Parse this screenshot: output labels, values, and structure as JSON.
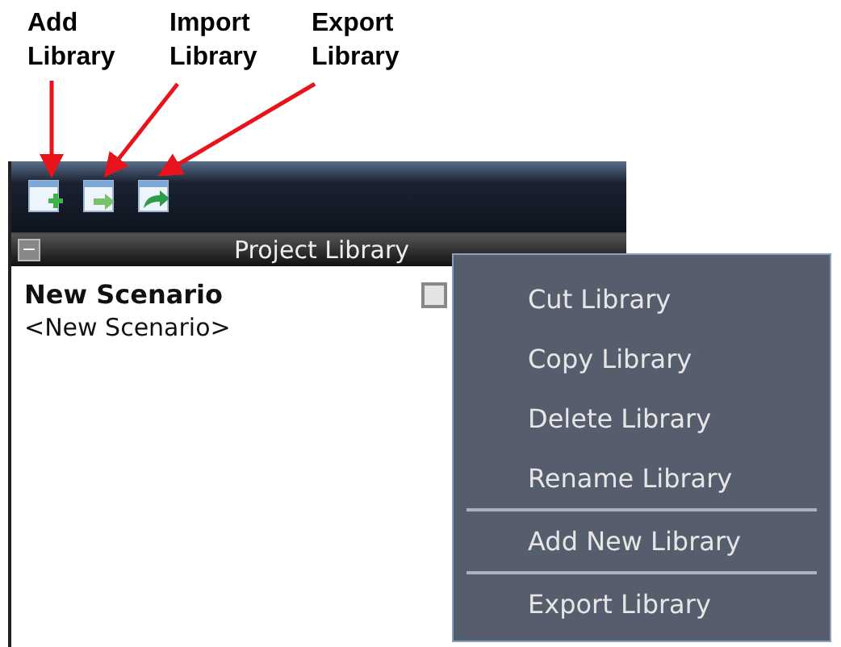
{
  "annotations": [
    {
      "label": "Add Library"
    },
    {
      "label": "Import Library"
    },
    {
      "label": "Export Library"
    }
  ],
  "toolbar": {
    "buttons": [
      {
        "kind": "add"
      },
      {
        "kind": "import"
      },
      {
        "kind": "export"
      }
    ]
  },
  "panel": {
    "title": "Project Library",
    "collapse_glyph": "−"
  },
  "tree": [
    {
      "label": "New Scenario",
      "bold": true
    },
    {
      "label": "<New Scenario>",
      "bold": false
    }
  ],
  "context_menu": {
    "groups": [
      [
        "Cut Library",
        "Copy Library",
        "Delete Library",
        "Rename Library"
      ],
      [
        "Add New Library"
      ],
      [
        "Export Library"
      ]
    ]
  }
}
